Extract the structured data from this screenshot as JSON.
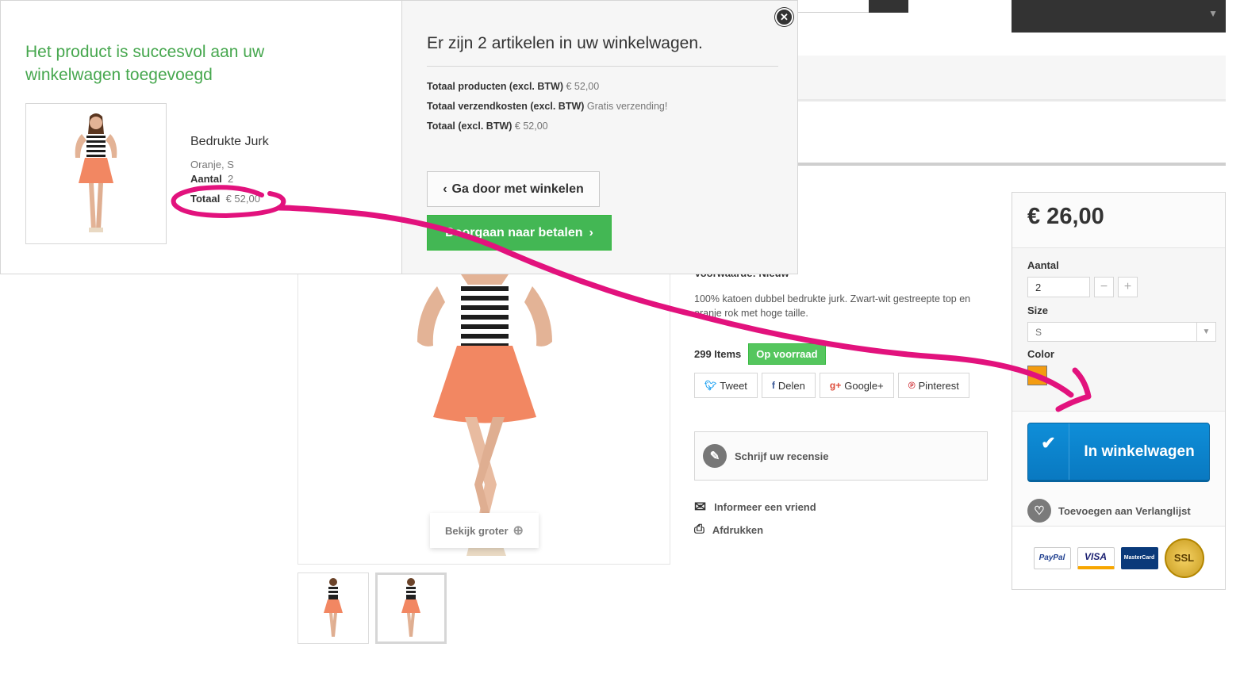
{
  "modal": {
    "success_title": "Het product is succesvol aan uw winkelwagen toegevoegd",
    "product": {
      "name": "Bedrukte Jurk",
      "attributes": "Oranje, S",
      "quantity_label": "Aantal",
      "quantity": "2",
      "total_label": "Totaal",
      "total": "€ 52,00"
    },
    "cart_summary": {
      "heading": "Er zijn 2 artikelen in uw winkelwagen.",
      "lines": [
        {
          "label": "Totaal producten (excl. BTW)",
          "value": "€ 52,00"
        },
        {
          "label": "Totaal verzendkosten (excl. BTW)",
          "value": "Gratis verzending!"
        },
        {
          "label": "Totaal (excl. BTW)",
          "value": "€ 52,00"
        }
      ]
    },
    "continue_label": "Ga door met winkelen",
    "checkout_label": "Doorgaan naar betalen",
    "close_icon": "close-icon"
  },
  "product_page": {
    "zoom_label": "Bekijk groter",
    "condition": "Voorwaarde: Nieuw",
    "description": "100% katoen dubbel bedrukte jurk. Zwart-wit gestreepte top en oranje rok met hoge taille.",
    "stock_count": "299 Items",
    "stock_status": "Op voorraad",
    "stock_color": "#55c65e",
    "social": [
      {
        "icon": "twitter-icon",
        "label": "Tweet"
      },
      {
        "icon": "facebook-icon",
        "label": "Delen"
      },
      {
        "icon": "googleplus-icon",
        "label": "Google+"
      },
      {
        "icon": "pinterest-icon",
        "label": "Pinterest"
      }
    ],
    "review_label": "Schrijf uw recensie",
    "tell_friend_label": "Informeer een vriend",
    "print_label": "Afdrukken"
  },
  "buy_box": {
    "price": "€ 26,00",
    "quantity_label": "Aantal",
    "quantity_value": "2",
    "size_label": "Size",
    "size_value": "S",
    "color_label": "Color",
    "color_value": "#f39c11",
    "add_to_cart_label": "In winkelwagen",
    "wishlist_label": "Toevoegen aan Verlanglijst",
    "payment_icons": [
      {
        "icon": "paypal-icon",
        "text": "PayPal"
      },
      {
        "icon": "visa-icon",
        "text": "VISA"
      },
      {
        "icon": "mastercard-icon",
        "text": "MasterCard"
      },
      {
        "icon": "ssl-icon",
        "text": "SSL"
      }
    ]
  },
  "colors": {
    "success_green": "#46a74e",
    "checkout_green": "#43b754",
    "cart_blue": "#0f8ed8",
    "annotation_magenta": "#e2127d"
  }
}
